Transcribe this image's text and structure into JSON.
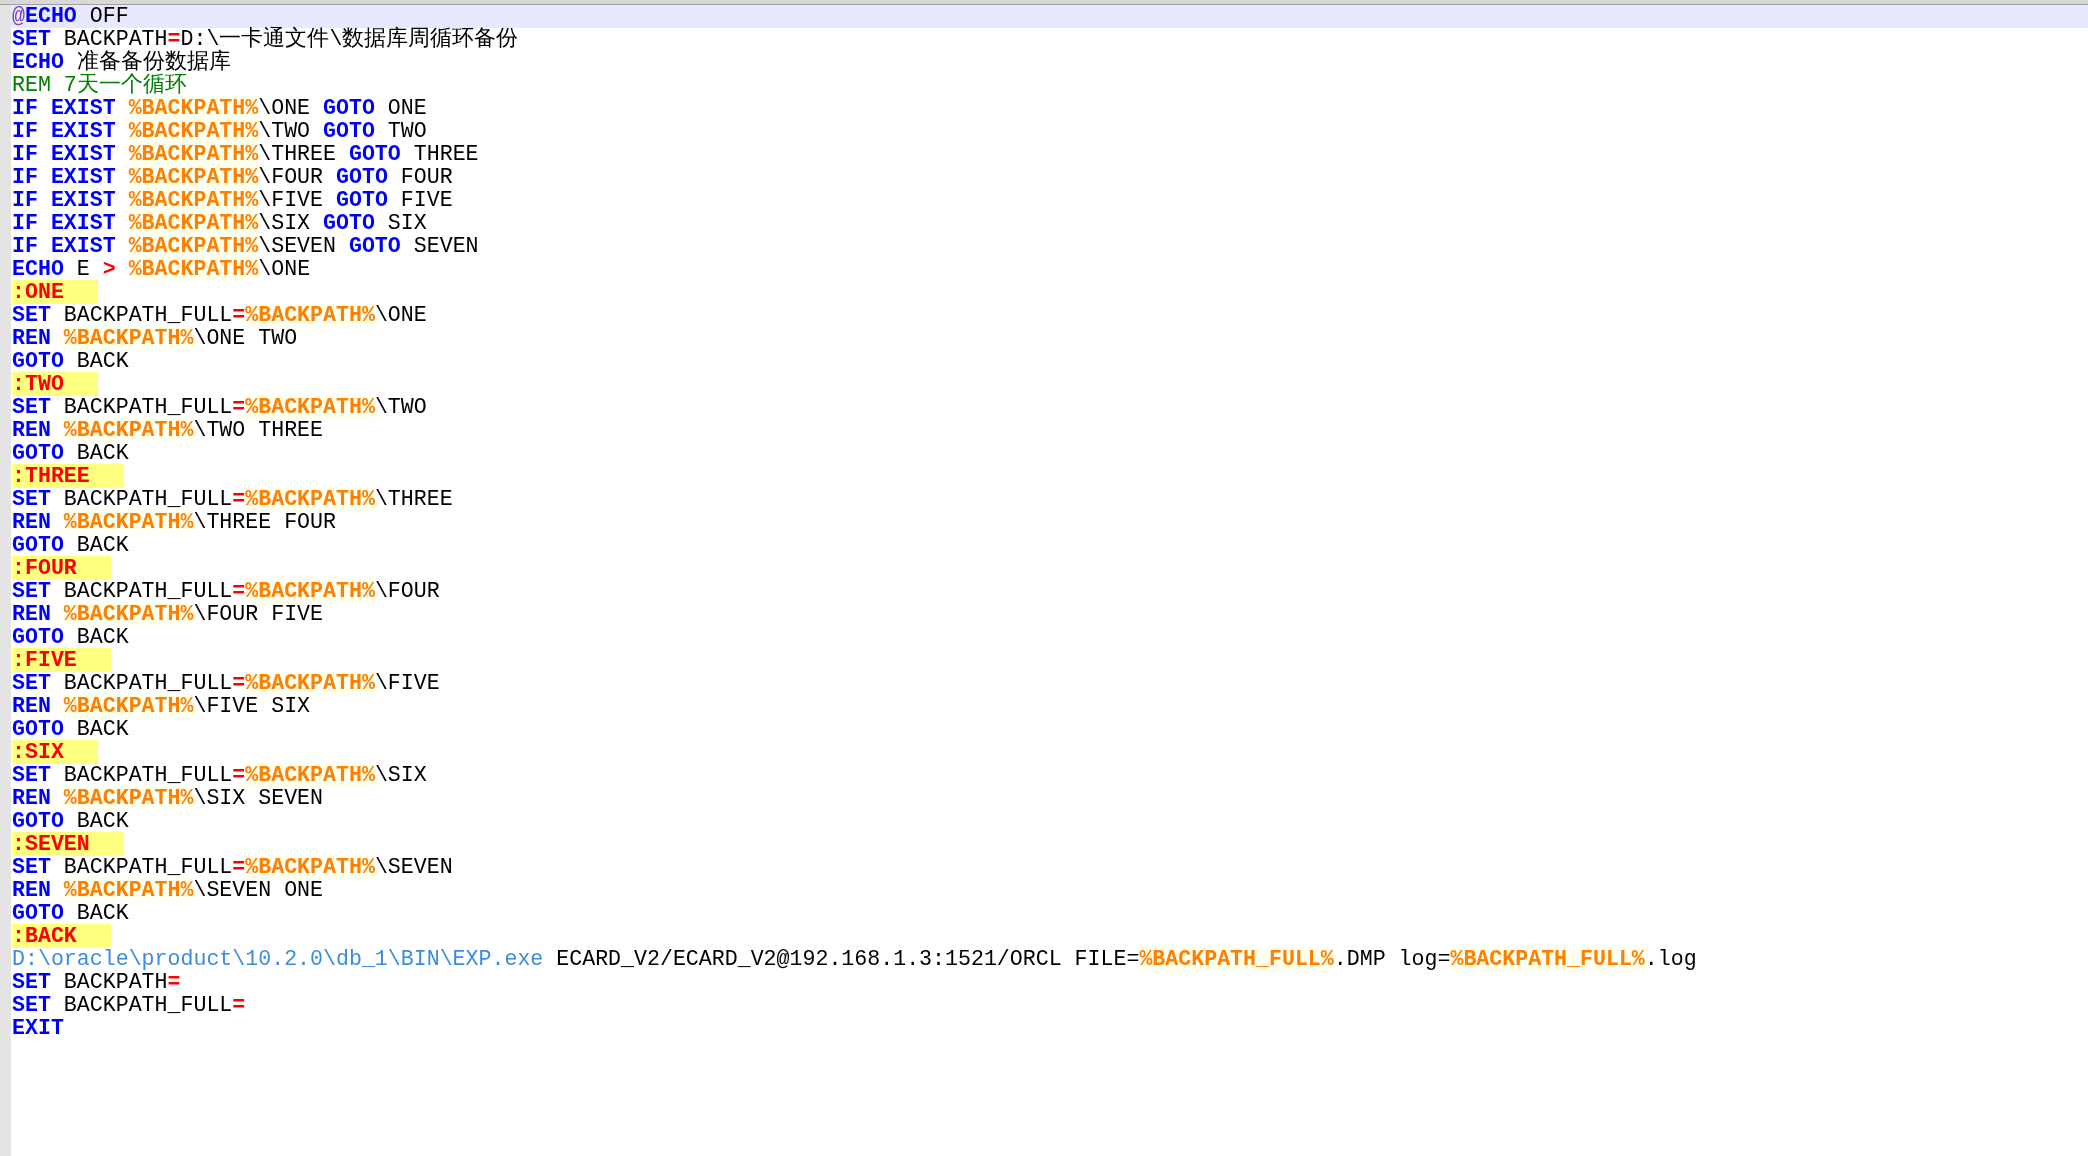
{
  "editor": {
    "lines": [
      {
        "current": true,
        "tokens": [
          {
            "kind": "at",
            "text": "@"
          },
          {
            "kind": "kw",
            "text": "ECHO"
          },
          {
            "kind": "txt",
            "text": " OFF"
          }
        ]
      },
      {
        "current": false,
        "tokens": [
          {
            "kind": "kw",
            "text": "SET"
          },
          {
            "kind": "txt",
            "text": " BACKPATH"
          },
          {
            "kind": "op",
            "text": "="
          },
          {
            "kind": "txt",
            "text": "D:\\一卡通文件\\数据库周循环备份"
          }
        ]
      },
      {
        "current": false,
        "tokens": [
          {
            "kind": "kw",
            "text": "ECHO"
          },
          {
            "kind": "txt",
            "text": " 准备备份数据库"
          }
        ]
      },
      {
        "current": false,
        "tokens": [
          {
            "kind": "cmt",
            "text": "REM 7天一个循环"
          }
        ]
      },
      {
        "current": false,
        "tokens": [
          {
            "kind": "kw",
            "text": "IF EXIST "
          },
          {
            "kind": "var",
            "text": "%BACKPATH%"
          },
          {
            "kind": "txt",
            "text": "\\ONE "
          },
          {
            "kind": "kw",
            "text": "GOTO"
          },
          {
            "kind": "txt",
            "text": " ONE"
          }
        ]
      },
      {
        "current": false,
        "tokens": [
          {
            "kind": "kw",
            "text": "IF EXIST "
          },
          {
            "kind": "var",
            "text": "%BACKPATH%"
          },
          {
            "kind": "txt",
            "text": "\\TWO "
          },
          {
            "kind": "kw",
            "text": "GOTO"
          },
          {
            "kind": "txt",
            "text": " TWO"
          }
        ]
      },
      {
        "current": false,
        "tokens": [
          {
            "kind": "kw",
            "text": "IF EXIST "
          },
          {
            "kind": "var",
            "text": "%BACKPATH%"
          },
          {
            "kind": "txt",
            "text": "\\THREE "
          },
          {
            "kind": "kw",
            "text": "GOTO"
          },
          {
            "kind": "txt",
            "text": " THREE"
          }
        ]
      },
      {
        "current": false,
        "tokens": [
          {
            "kind": "kw",
            "text": "IF EXIST "
          },
          {
            "kind": "var",
            "text": "%BACKPATH%"
          },
          {
            "kind": "txt",
            "text": "\\FOUR "
          },
          {
            "kind": "kw",
            "text": "GOTO"
          },
          {
            "kind": "txt",
            "text": " FOUR"
          }
        ]
      },
      {
        "current": false,
        "tokens": [
          {
            "kind": "kw",
            "text": "IF EXIST "
          },
          {
            "kind": "var",
            "text": "%BACKPATH%"
          },
          {
            "kind": "txt",
            "text": "\\FIVE "
          },
          {
            "kind": "kw",
            "text": "GOTO"
          },
          {
            "kind": "txt",
            "text": " FIVE"
          }
        ]
      },
      {
        "current": false,
        "tokens": [
          {
            "kind": "kw",
            "text": "IF EXIST "
          },
          {
            "kind": "var",
            "text": "%BACKPATH%"
          },
          {
            "kind": "txt",
            "text": "\\SIX "
          },
          {
            "kind": "kw",
            "text": "GOTO"
          },
          {
            "kind": "txt",
            "text": " SIX"
          }
        ]
      },
      {
        "current": false,
        "tokens": [
          {
            "kind": "kw",
            "text": "IF EXIST "
          },
          {
            "kind": "var",
            "text": "%BACKPATH%"
          },
          {
            "kind": "txt",
            "text": "\\SEVEN "
          },
          {
            "kind": "kw",
            "text": "GOTO"
          },
          {
            "kind": "txt",
            "text": " SEVEN"
          }
        ]
      },
      {
        "current": false,
        "tokens": [
          {
            "kind": "kw",
            "text": "ECHO"
          },
          {
            "kind": "txt",
            "text": " E "
          },
          {
            "kind": "op",
            "text": "> "
          },
          {
            "kind": "var",
            "text": "%BACKPATH%"
          },
          {
            "kind": "txt",
            "text": "\\ONE"
          }
        ]
      },
      {
        "current": false,
        "tokens": [
          {
            "kind": "lbl",
            "text": ":ONE"
          }
        ]
      },
      {
        "current": false,
        "tokens": [
          {
            "kind": "kw",
            "text": "SET"
          },
          {
            "kind": "txt",
            "text": " BACKPATH_FULL"
          },
          {
            "kind": "op",
            "text": "="
          },
          {
            "kind": "var",
            "text": "%BACKPATH%"
          },
          {
            "kind": "txt",
            "text": "\\ONE"
          }
        ]
      },
      {
        "current": false,
        "tokens": [
          {
            "kind": "kw",
            "text": "REN "
          },
          {
            "kind": "var",
            "text": "%BACKPATH%"
          },
          {
            "kind": "txt",
            "text": "\\ONE TWO"
          }
        ]
      },
      {
        "current": false,
        "tokens": [
          {
            "kind": "kw",
            "text": "GOTO"
          },
          {
            "kind": "txt",
            "text": " BACK"
          }
        ]
      },
      {
        "current": false,
        "tokens": [
          {
            "kind": "lbl",
            "text": ":TWO"
          }
        ]
      },
      {
        "current": false,
        "tokens": [
          {
            "kind": "kw",
            "text": "SET"
          },
          {
            "kind": "txt",
            "text": " BACKPATH_FULL"
          },
          {
            "kind": "op",
            "text": "="
          },
          {
            "kind": "var",
            "text": "%BACKPATH%"
          },
          {
            "kind": "txt",
            "text": "\\TWO"
          }
        ]
      },
      {
        "current": false,
        "tokens": [
          {
            "kind": "kw",
            "text": "REN "
          },
          {
            "kind": "var",
            "text": "%BACKPATH%"
          },
          {
            "kind": "txt",
            "text": "\\TWO THREE"
          }
        ]
      },
      {
        "current": false,
        "tokens": [
          {
            "kind": "kw",
            "text": "GOTO"
          },
          {
            "kind": "txt",
            "text": " BACK"
          }
        ]
      },
      {
        "current": false,
        "tokens": [
          {
            "kind": "lbl",
            "text": ":THREE"
          }
        ]
      },
      {
        "current": false,
        "tokens": [
          {
            "kind": "kw",
            "text": "SET"
          },
          {
            "kind": "txt",
            "text": " BACKPATH_FULL"
          },
          {
            "kind": "op",
            "text": "="
          },
          {
            "kind": "var",
            "text": "%BACKPATH%"
          },
          {
            "kind": "txt",
            "text": "\\THREE"
          }
        ]
      },
      {
        "current": false,
        "tokens": [
          {
            "kind": "kw",
            "text": "REN "
          },
          {
            "kind": "var",
            "text": "%BACKPATH%"
          },
          {
            "kind": "txt",
            "text": "\\THREE FOUR"
          }
        ]
      },
      {
        "current": false,
        "tokens": [
          {
            "kind": "kw",
            "text": "GOTO"
          },
          {
            "kind": "txt",
            "text": " BACK"
          }
        ]
      },
      {
        "current": false,
        "tokens": [
          {
            "kind": "lbl",
            "text": ":FOUR"
          }
        ]
      },
      {
        "current": false,
        "tokens": [
          {
            "kind": "kw",
            "text": "SET"
          },
          {
            "kind": "txt",
            "text": " BACKPATH_FULL"
          },
          {
            "kind": "op",
            "text": "="
          },
          {
            "kind": "var",
            "text": "%BACKPATH%"
          },
          {
            "kind": "txt",
            "text": "\\FOUR"
          }
        ]
      },
      {
        "current": false,
        "tokens": [
          {
            "kind": "kw",
            "text": "REN "
          },
          {
            "kind": "var",
            "text": "%BACKPATH%"
          },
          {
            "kind": "txt",
            "text": "\\FOUR FIVE"
          }
        ]
      },
      {
        "current": false,
        "tokens": [
          {
            "kind": "kw",
            "text": "GOTO"
          },
          {
            "kind": "txt",
            "text": " BACK"
          }
        ]
      },
      {
        "current": false,
        "tokens": [
          {
            "kind": "lbl",
            "text": ":FIVE"
          }
        ]
      },
      {
        "current": false,
        "tokens": [
          {
            "kind": "kw",
            "text": "SET"
          },
          {
            "kind": "txt",
            "text": " BACKPATH_FULL"
          },
          {
            "kind": "op",
            "text": "="
          },
          {
            "kind": "var",
            "text": "%BACKPATH%"
          },
          {
            "kind": "txt",
            "text": "\\FIVE"
          }
        ]
      },
      {
        "current": false,
        "tokens": [
          {
            "kind": "kw",
            "text": "REN "
          },
          {
            "kind": "var",
            "text": "%BACKPATH%"
          },
          {
            "kind": "txt",
            "text": "\\FIVE SIX"
          }
        ]
      },
      {
        "current": false,
        "tokens": [
          {
            "kind": "kw",
            "text": "GOTO"
          },
          {
            "kind": "txt",
            "text": " BACK"
          }
        ]
      },
      {
        "current": false,
        "tokens": [
          {
            "kind": "lbl",
            "text": ":SIX"
          }
        ]
      },
      {
        "current": false,
        "tokens": [
          {
            "kind": "kw",
            "text": "SET"
          },
          {
            "kind": "txt",
            "text": " BACKPATH_FULL"
          },
          {
            "kind": "op",
            "text": "="
          },
          {
            "kind": "var",
            "text": "%BACKPATH%"
          },
          {
            "kind": "txt",
            "text": "\\SIX"
          }
        ]
      },
      {
        "current": false,
        "tokens": [
          {
            "kind": "kw",
            "text": "REN "
          },
          {
            "kind": "var",
            "text": "%BACKPATH%"
          },
          {
            "kind": "txt",
            "text": "\\SIX SEVEN"
          }
        ]
      },
      {
        "current": false,
        "tokens": [
          {
            "kind": "kw",
            "text": "GOTO"
          },
          {
            "kind": "txt",
            "text": " BACK"
          }
        ]
      },
      {
        "current": false,
        "tokens": [
          {
            "kind": "lbl",
            "text": ":SEVEN"
          }
        ]
      },
      {
        "current": false,
        "tokens": [
          {
            "kind": "kw",
            "text": "SET"
          },
          {
            "kind": "txt",
            "text": " BACKPATH_FULL"
          },
          {
            "kind": "op",
            "text": "="
          },
          {
            "kind": "var",
            "text": "%BACKPATH%"
          },
          {
            "kind": "txt",
            "text": "\\SEVEN"
          }
        ]
      },
      {
        "current": false,
        "tokens": [
          {
            "kind": "kw",
            "text": "REN "
          },
          {
            "kind": "var",
            "text": "%BACKPATH%"
          },
          {
            "kind": "txt",
            "text": "\\SEVEN ONE"
          }
        ]
      },
      {
        "current": false,
        "tokens": [
          {
            "kind": "kw",
            "text": "GOTO"
          },
          {
            "kind": "txt",
            "text": " BACK"
          }
        ]
      },
      {
        "current": false,
        "tokens": [
          {
            "kind": "lbl",
            "text": ":BACK"
          }
        ]
      },
      {
        "current": false,
        "tokens": [
          {
            "kind": "path",
            "text": "D:\\oracle\\product\\10.2.0\\db_1\\BIN\\EXP.exe"
          },
          {
            "kind": "txt",
            "text": " ECARD_V2/ECARD_V2@192.168.1.3:1521/ORCL FILE="
          },
          {
            "kind": "var",
            "text": "%BACKPATH_FULL%"
          },
          {
            "kind": "txt",
            "text": ".DMP log="
          },
          {
            "kind": "var",
            "text": "%BACKPATH_FULL%"
          },
          {
            "kind": "txt",
            "text": ".log"
          }
        ]
      },
      {
        "current": false,
        "tokens": [
          {
            "kind": "kw",
            "text": "SET"
          },
          {
            "kind": "txt",
            "text": " BACKPATH"
          },
          {
            "kind": "op",
            "text": "="
          }
        ]
      },
      {
        "current": false,
        "tokens": [
          {
            "kind": "kw",
            "text": "SET"
          },
          {
            "kind": "txt",
            "text": " BACKPATH_FULL"
          },
          {
            "kind": "op",
            "text": "="
          }
        ]
      },
      {
        "current": false,
        "tokens": [
          {
            "kind": "kw",
            "text": "EXIT"
          }
        ]
      }
    ]
  }
}
